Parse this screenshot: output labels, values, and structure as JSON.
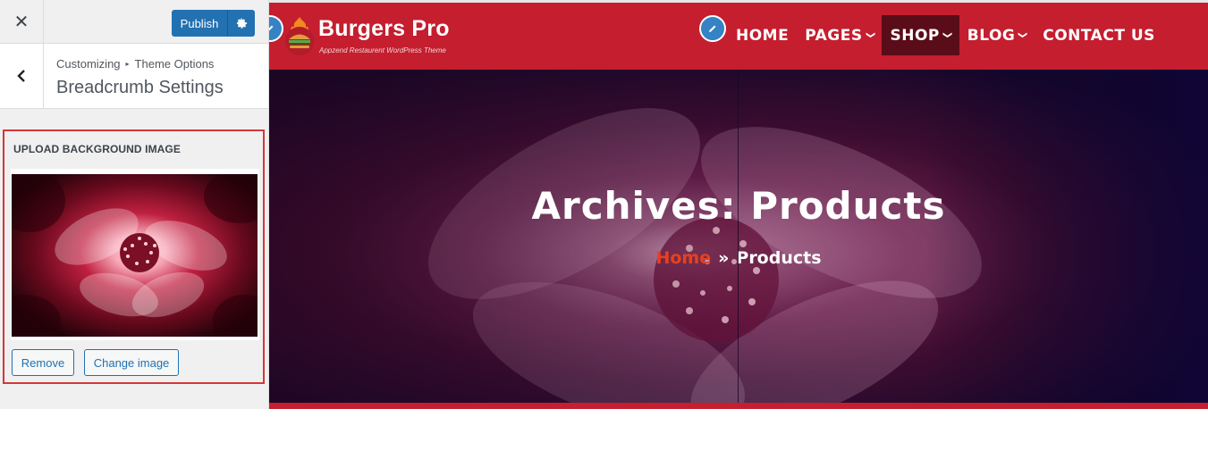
{
  "sidebar": {
    "close_label": "✕",
    "publish_label": "Publish",
    "breadcrumb": [
      "Customizing",
      "Theme Options"
    ],
    "section_title": "Breadcrumb Settings",
    "control": {
      "label": "UPLOAD BACKGROUND IMAGE",
      "remove_label": "Remove",
      "change_label": "Change image"
    }
  },
  "site": {
    "brand_name": "Burgers Pro",
    "brand_tagline": "Appzend Restaurent WordPress Theme",
    "nav": [
      {
        "label": "HOME",
        "dropdown": false,
        "active": false
      },
      {
        "label": "PAGES",
        "dropdown": true,
        "active": false
      },
      {
        "label": "SHOP",
        "dropdown": true,
        "active": true
      },
      {
        "label": "BLOG",
        "dropdown": true,
        "active": false
      },
      {
        "label": "CONTACT US",
        "dropdown": false,
        "active": false
      }
    ],
    "hero": {
      "title": "Archives: Products",
      "crumb_home": "Home",
      "crumb_sep": "»",
      "crumb_current": "Products"
    }
  },
  "colors": {
    "accent_blue": "#2271b1",
    "brand_red": "#c41e2f",
    "crumb_home": "#e8401e",
    "highlight_border": "#d63638"
  }
}
